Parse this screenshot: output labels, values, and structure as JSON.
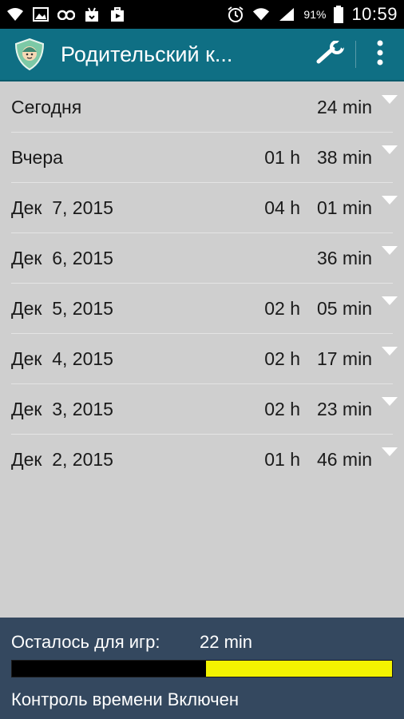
{
  "status_bar": {
    "battery_percent": "91%",
    "time": "10:59",
    "left_icons": [
      "wifi-icon",
      "image-icon",
      "binoculars-icon",
      "download-icon",
      "play-store-icon"
    ],
    "right_icons": [
      "alarm-icon",
      "wifi-icon",
      "signal-icon",
      "battery-icon"
    ]
  },
  "action_bar": {
    "title": "Родительский к...",
    "app_icon": "parental-shield-icon",
    "actions": [
      "wrench-icon",
      "overflow-menu-icon"
    ],
    "color": "#0f6f84"
  },
  "usage_list": [
    {
      "date": "Сегодня",
      "hours": "",
      "minutes": "24 min"
    },
    {
      "date": "Вчера",
      "hours": "01 h",
      "minutes": "38 min"
    },
    {
      "date": "Дек  7, 2015",
      "hours": "04 h",
      "minutes": "01 min"
    },
    {
      "date": "Дек  6, 2015",
      "hours": "",
      "minutes": "36 min"
    },
    {
      "date": "Дек  5, 2015",
      "hours": "02 h",
      "minutes": "05 min"
    },
    {
      "date": "Дек  4, 2015",
      "hours": "02 h",
      "minutes": "17 min"
    },
    {
      "date": "Дек  3, 2015",
      "hours": "02 h",
      "minutes": "23 min"
    },
    {
      "date": "Дек  2, 2015",
      "hours": "01 h",
      "minutes": "46 min"
    }
  ],
  "footer": {
    "remaining_label": "Осталось для игр:",
    "remaining_value": "22 min",
    "progress_remaining_fraction": 0.49,
    "progress_fill_color": "#f3f300",
    "control_status": "Контроль времени Включен",
    "color": "#34485f"
  }
}
